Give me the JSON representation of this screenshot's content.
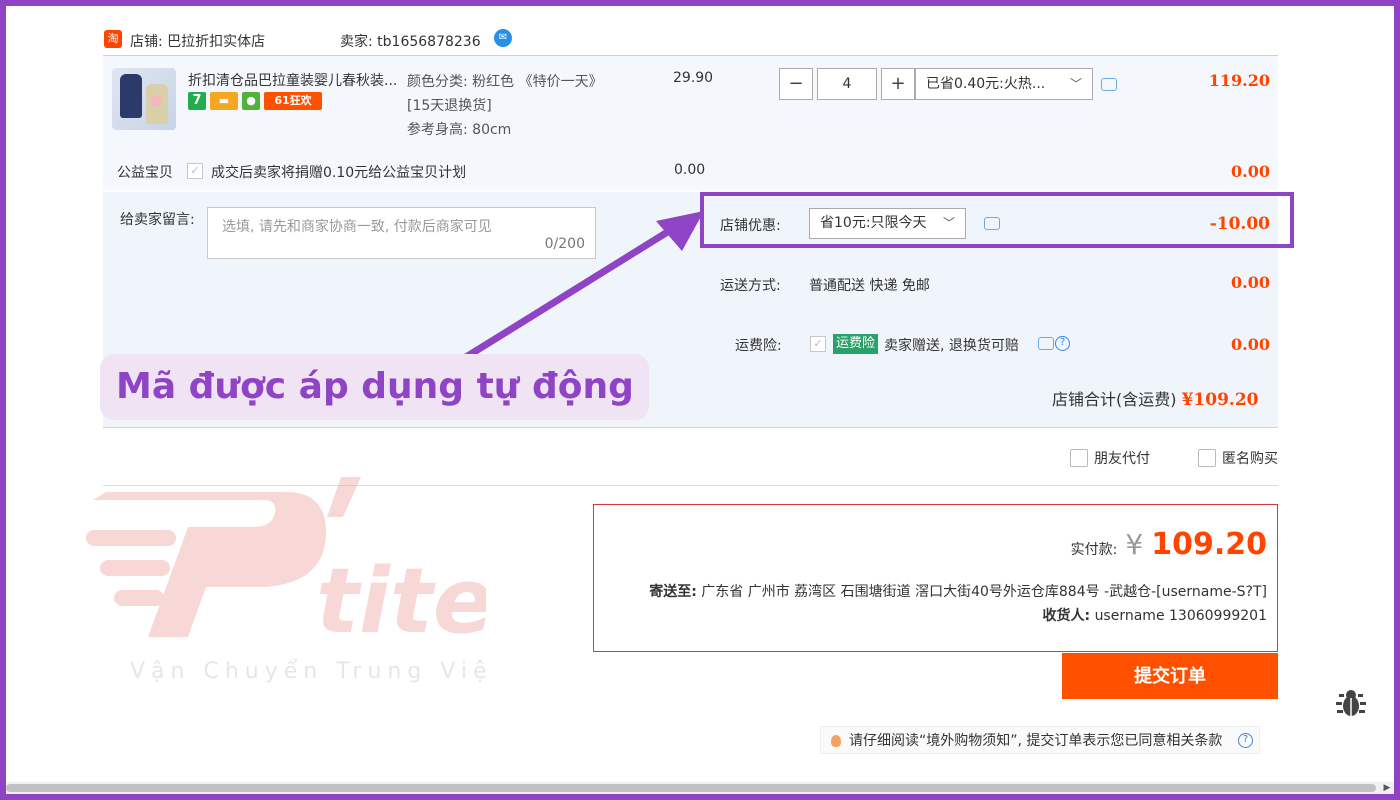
{
  "shop": {
    "badge": "淘",
    "name_label": "店铺: 巴拉折扣实体店",
    "seller_label": "卖家: tb1656878236"
  },
  "item": {
    "title": "折扣清仓品巴拉童装婴儿春秋装...",
    "badges": [
      "7",
      "61狂欢"
    ],
    "sku_lines": [
      "颜色分类: 粉红色 《特价一天》",
      "[15天退换货]",
      "参考身高: 80cm"
    ],
    "price": "29.90",
    "qty_minus": "−",
    "qty_value": "4",
    "qty_plus": "+",
    "promo_select": "已省0.40元:火热...",
    "subtotal": "119.20"
  },
  "charity": {
    "label": "公益宝贝",
    "text": "成交后卖家将捐赠0.10元给公益宝贝计划",
    "price": "0.00",
    "total": "0.00"
  },
  "message": {
    "label": "给卖家留言:",
    "placeholder": "选填, 请先和商家协商一致, 付款后商家可见",
    "count": "0/200"
  },
  "shop_discount": {
    "label": "店铺优惠:",
    "select": "省10元:只限今天",
    "value": "-10.00"
  },
  "shipping": {
    "label": "运送方式:",
    "text": "普通配送 快递 免邮",
    "value": "0.00"
  },
  "insurance": {
    "label": "运费险:",
    "tag": "运费险",
    "text": "卖家赠送, 退换货可赔",
    "value": "0.00"
  },
  "shop_total": {
    "label": "店铺合计(含运费)",
    "value": "¥109.20"
  },
  "options": {
    "friend_pay": "朋友代付",
    "anonymous": "匿名购买"
  },
  "annotation": "Mã được áp dụng tự động",
  "summary": {
    "pay_label": "实付款:",
    "currency": "¥",
    "amount": "109.20",
    "address_label": "寄送至:",
    "address": "广东省 广州市 荔湾区 石围塘街道 滘口大街40号外运仓库884号 -武越仓-[username-S?T]",
    "receiver_label": "收货人:",
    "receiver": "username 13060999201"
  },
  "submit_label": "提交订单",
  "notice": "请仔细阅读“境外购物须知”, 提交订单表示您已同意相关条款",
  "watermark": {
    "brand": "Ptite",
    "tagline": "Vận Chuyển Trung Việt"
  },
  "colors": {
    "accent": "#ff4400",
    "annotation": "#8e44c5",
    "submit": "#ff5000"
  }
}
